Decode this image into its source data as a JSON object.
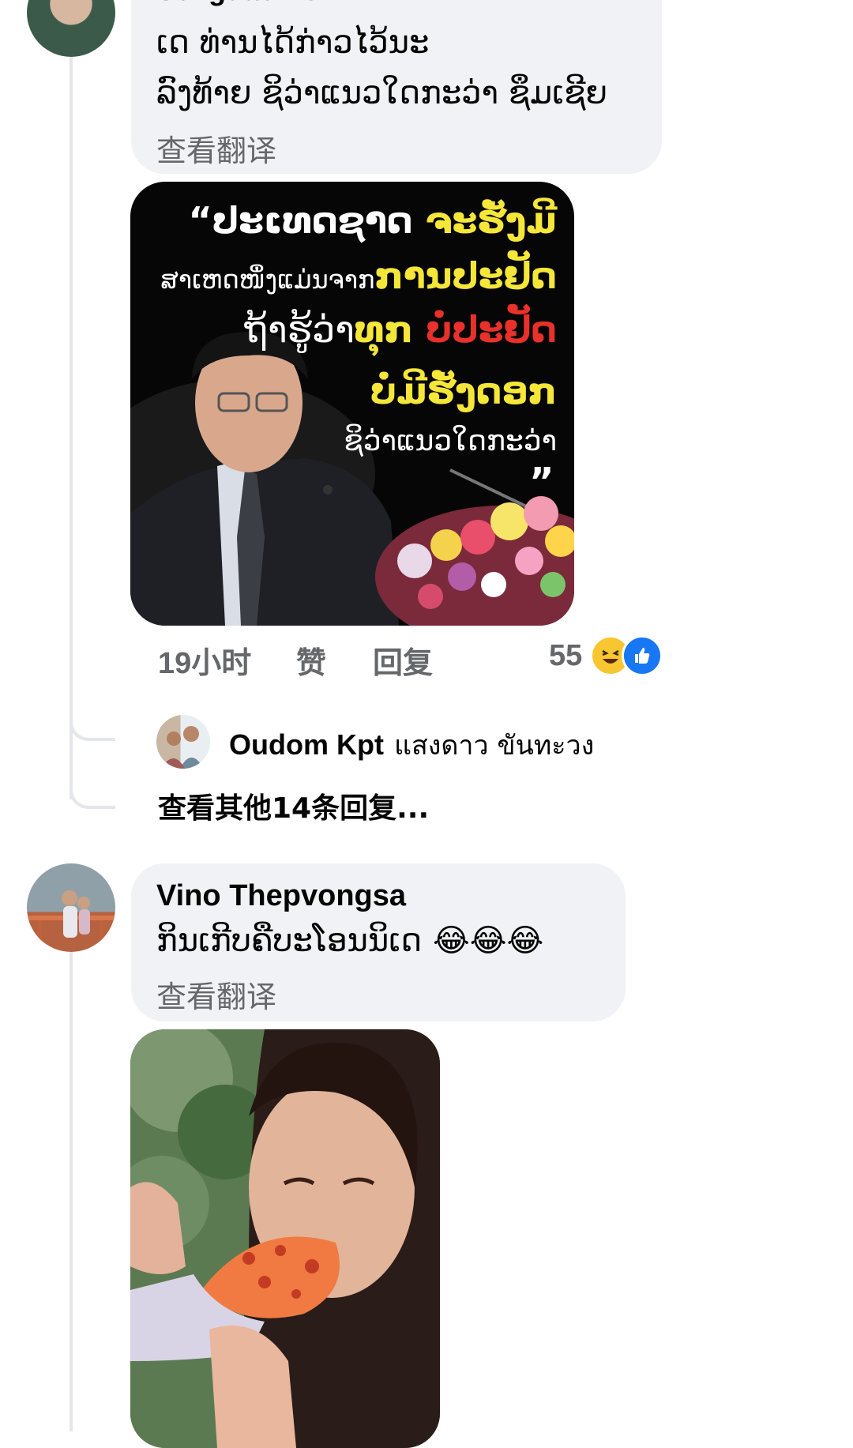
{
  "comment1": {
    "author": "Sengdao Ktv",
    "lines": [
      "ເດ ທ່ານໄດ້ກ່າວໄວ້ນະ",
      "ລົງທ້າຍ ຊິວ່າແນວໃດກະວ່າ ຊຶມເຊີຍ"
    ],
    "translate_label": "查看翻译",
    "image_quote": {
      "line1_white": "“ປະເທດຊາດ",
      "line1_yellow": "ຈະຮັ່ງມີ",
      "line2_white": "ສາເຫດໜຶ່ງແມ່ນຈາກ",
      "line2_yellow": "ການປະຢັດ",
      "line3_white": "ຖ້າຮູ້ວ່າ",
      "line3_yellow": "ທຸກ",
      "line3_red": "ບໍ່ປະຢັດ",
      "line4_yellow": "ບໍ່ມີຮັ່ງດອກ",
      "line5_white": "ຊິວ່າແນວໃດກະວ່າ",
      "closing_quote": "”"
    },
    "time": "19小时",
    "like_label": "赞",
    "reply_label": "回复",
    "reaction_count": "55",
    "reaction_icons": [
      "laughing-emoji",
      "like-icon"
    ]
  },
  "reply_preview": {
    "author": "Oudom Kpt",
    "snippet": "แสงดาว ขันทะวง"
  },
  "more_replies_label": "查看其他14条回复...",
  "comment2": {
    "author": "Vino Thepvongsa",
    "text": "ກິນເກີບຄືບະໂອນນິເດ",
    "emojis": "😂😂😂",
    "translate_label": "查看翻译"
  },
  "colors": {
    "bubble": "#f0f2f5",
    "secondary_text": "#65676b",
    "quote_yellow": "#f5e63a",
    "quote_red": "#e8312a",
    "like_blue": "#1877f2"
  }
}
